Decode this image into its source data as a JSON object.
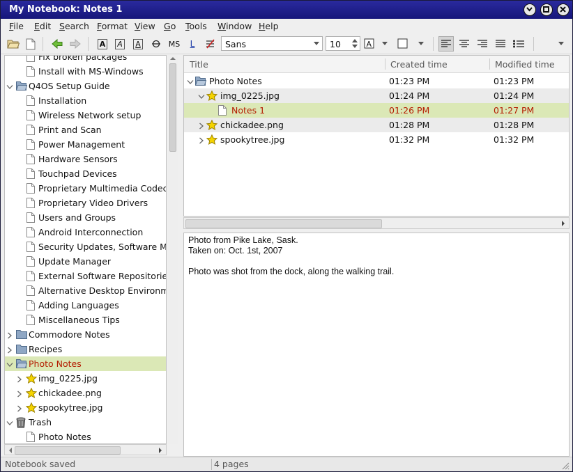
{
  "window": {
    "title": "My Notebook: Notes 1"
  },
  "menu": [
    "File",
    "Edit",
    "Search",
    "Format",
    "View",
    "Go",
    "Tools",
    "Window",
    "Help"
  ],
  "toolbar": {
    "font": "Sans",
    "size": "10",
    "bold": "A",
    "italic": "A",
    "underline": "A",
    "monospace": "MS",
    "link": "L"
  },
  "tree": [
    {
      "label": "Fix broken packages",
      "depth": 2,
      "icon": "page-icon"
    },
    {
      "label": "Install with MS-Windows",
      "depth": 2,
      "icon": "page-icon"
    },
    {
      "label": "Q4OS Setup Guide",
      "depth": 1,
      "icon": "folder-open-icon",
      "expander": "open"
    },
    {
      "label": "Installation",
      "depth": 2,
      "icon": "page-icon"
    },
    {
      "label": "Wireless Network setup",
      "depth": 2,
      "icon": "page-icon"
    },
    {
      "label": "Print and Scan",
      "depth": 2,
      "icon": "page-icon"
    },
    {
      "label": "Power Management",
      "depth": 2,
      "icon": "page-icon"
    },
    {
      "label": "Hardware Sensors",
      "depth": 2,
      "icon": "page-icon"
    },
    {
      "label": "Touchpad Devices",
      "depth": 2,
      "icon": "page-icon"
    },
    {
      "label": "Proprietary Multimedia Codecs",
      "depth": 2,
      "icon": "page-icon"
    },
    {
      "label": "Proprietary Video Drivers",
      "depth": 2,
      "icon": "page-icon"
    },
    {
      "label": "Users and Groups",
      "depth": 2,
      "icon": "page-icon"
    },
    {
      "label": "Android Interconnection",
      "depth": 2,
      "icon": "page-icon"
    },
    {
      "label": "Security Updates, Software Maintenance",
      "depth": 2,
      "icon": "page-icon"
    },
    {
      "label": "Update Manager",
      "depth": 2,
      "icon": "page-icon"
    },
    {
      "label": "External Software Repositories",
      "depth": 2,
      "icon": "page-icon"
    },
    {
      "label": "Alternative Desktop Environments",
      "depth": 2,
      "icon": "page-icon"
    },
    {
      "label": "Adding Languages",
      "depth": 2,
      "icon": "page-icon"
    },
    {
      "label": "Miscellaneous Tips",
      "depth": 2,
      "icon": "page-icon"
    },
    {
      "label": "Commodore Notes",
      "depth": 1,
      "icon": "folder-icon",
      "expander": "closed"
    },
    {
      "label": "Recipes",
      "depth": 1,
      "icon": "folder-icon",
      "expander": "closed"
    },
    {
      "label": "Photo Notes",
      "depth": 1,
      "icon": "folder-open-icon",
      "expander": "open",
      "selected": true
    },
    {
      "label": "img_0225.jpg",
      "depth": 2,
      "icon": "star-icon",
      "expander": "closed"
    },
    {
      "label": "chickadee.png",
      "depth": 2,
      "icon": "star-icon",
      "expander": "closed"
    },
    {
      "label": "spookytree.jpg",
      "depth": 2,
      "icon": "star-icon",
      "expander": "closed"
    },
    {
      "label": "Trash",
      "depth": 1,
      "icon": "trash-icon",
      "expander": "open"
    },
    {
      "label": "Photo Notes",
      "depth": 2,
      "icon": "page-icon"
    }
  ],
  "list": {
    "headers": {
      "title": "Title",
      "created": "Created time",
      "modified": "Modified time"
    },
    "rows": [
      {
        "title": "Photo Notes",
        "created": "01:23 PM",
        "modified": "01:23 PM",
        "depth": 0,
        "icon": "folder-open-icon",
        "expander": "open"
      },
      {
        "title": "img_0225.jpg",
        "created": "01:24 PM",
        "modified": "01:24 PM",
        "depth": 1,
        "icon": "star-icon",
        "expander": "open"
      },
      {
        "title": "Notes 1",
        "created": "01:26 PM",
        "modified": "01:27 PM",
        "depth": 2,
        "icon": "page-icon",
        "selected": true
      },
      {
        "title": "chickadee.png",
        "created": "01:28 PM",
        "modified": "01:28 PM",
        "depth": 1,
        "icon": "star-icon",
        "expander": "closed"
      },
      {
        "title": "spookytree.jpg",
        "created": "01:32 PM",
        "modified": "01:32 PM",
        "depth": 1,
        "icon": "star-icon",
        "expander": "closed"
      }
    ]
  },
  "editor": {
    "lines": [
      "Photo from Pike Lake, Sask.",
      "Taken on: Oct. 1st, 2007",
      "",
      "Photo was shot from the dock, along the walking trail."
    ]
  },
  "status": {
    "left": "Notebook saved",
    "right": "4 pages"
  },
  "colors": {
    "titlebar": "#1e1e8c",
    "selection": "#dbe8b6",
    "selected_text": "#b41c00",
    "star": "#f5d400",
    "folder": "#7d98b8"
  }
}
